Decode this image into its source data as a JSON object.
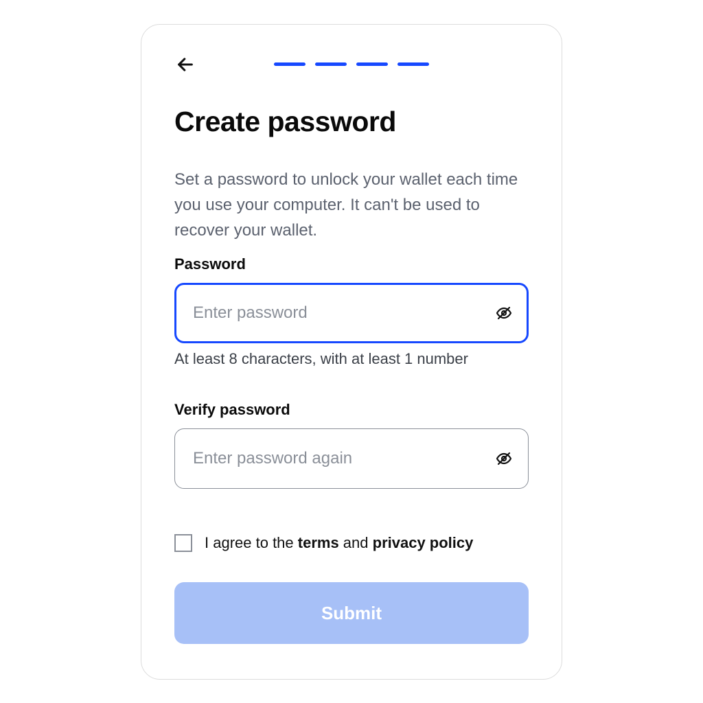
{
  "colors": {
    "accent": "#1648ff",
    "submit_disabled": "#a7c0f7"
  },
  "title": "Create password",
  "description": "Set a password to unlock your wallet each time you use your computer. It can't be used to recover your wallet.",
  "password": {
    "label": "Password",
    "placeholder": "Enter password",
    "value": "",
    "hint": "At least 8 characters, with at least 1 number"
  },
  "verify": {
    "label": "Verify password",
    "placeholder": "Enter password again",
    "value": ""
  },
  "consent": {
    "prefix": "I agree to the ",
    "terms": "terms",
    "middle": " and ",
    "privacy": "privacy policy",
    "checked": false
  },
  "submit_label": "Submit"
}
